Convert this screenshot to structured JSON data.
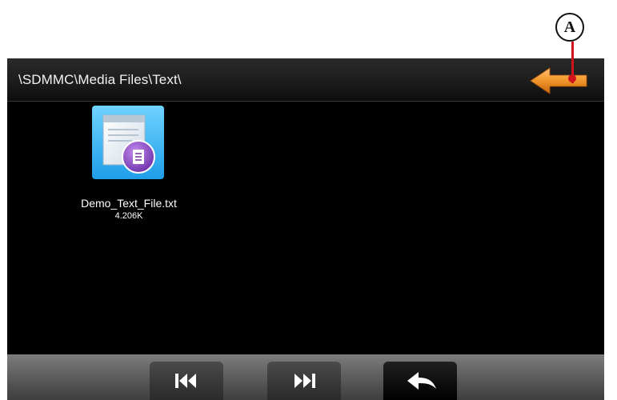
{
  "annotation": {
    "callout_label": "A",
    "callout_color": "#d0141c"
  },
  "header": {
    "path": "\\SDMMC\\Media Files\\Text\\",
    "up_button_icon": "orange-left-arrow-icon",
    "accent_color": "#f08a1c"
  },
  "files": [
    {
      "name": "Demo_Text_File.txt",
      "size": "4.206K",
      "icon": "text-document-icon"
    }
  ],
  "toolbar": {
    "buttons": [
      {
        "icon": "skip-previous-icon"
      },
      {
        "icon": "skip-next-icon"
      },
      {
        "icon": "return-arrow-icon"
      }
    ]
  }
}
